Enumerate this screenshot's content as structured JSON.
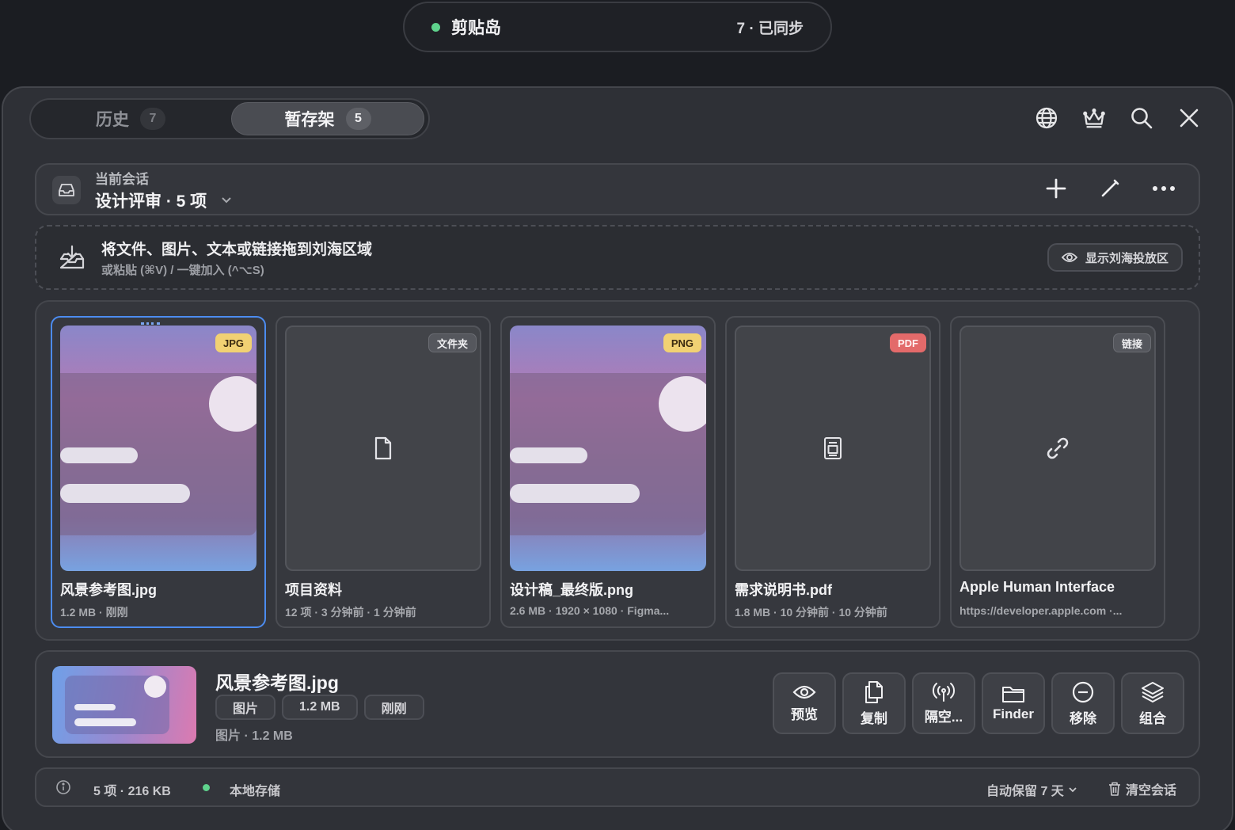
{
  "island": {
    "name": "剪贴岛",
    "sync": "7 · 已同步",
    "status_color": "#5fd38d"
  },
  "tabs": [
    {
      "label": "历史",
      "count": "7"
    },
    {
      "label": "暂存架",
      "count": "5"
    }
  ],
  "top_icons": [
    "globe-icon",
    "crown-icon",
    "search-icon",
    "close-icon"
  ],
  "session": {
    "label": "当前会话",
    "title": "设计评审 · 5 项"
  },
  "drop": {
    "title": "将文件、图片、文本或链接拖到刘海区域",
    "hint": "或粘贴 (⌘V) / 一键加入 (^⌥S)",
    "notch_button": "显示刘海投放区"
  },
  "cards": [
    {
      "badge": "JPG",
      "name": "风景参考图.jpg",
      "meta": "1.2 MB · 刚刚"
    },
    {
      "badge": "文件夹",
      "name": "项目资料",
      "meta": "12 项 · 3 分钟前 · 1 分钟前"
    },
    {
      "badge": "PNG",
      "name": "设计稿_最终版.png",
      "meta": "2.6 MB · 1920 × 1080 · Figma..."
    },
    {
      "badge": "PDF",
      "name": "需求说明书.pdf",
      "meta": "1.8 MB · 10 分钟前 · 10 分钟前"
    },
    {
      "badge": "链接",
      "name": "Apple Human Interface",
      "meta": "https://developer.apple.com ·..."
    }
  ],
  "detail": {
    "name": "风景参考图.jpg",
    "chips": [
      "图片",
      "1.2 MB",
      "刚刚"
    ],
    "sub": "图片 · 1.2 MB",
    "actions": [
      "预览",
      "复制",
      "隔空...",
      "Finder",
      "移除",
      "组合"
    ]
  },
  "footer": {
    "count": "5 项 · 216 KB",
    "storage": "本地存储",
    "retention": "自动保留 7 天",
    "clear": "清空会话"
  },
  "colors": {
    "accent": "#4c8cf0",
    "success": "#5fd38d",
    "badge_yellow": "#f1d173",
    "badge_red": "#e36a6a"
  }
}
